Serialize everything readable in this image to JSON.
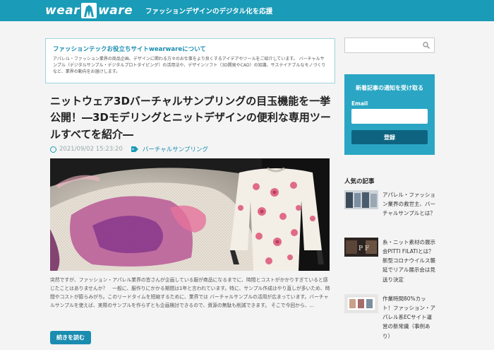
{
  "header": {
    "logo_text_left": "wear",
    "logo_text_right": "ware",
    "tagline": "ファッションデザインのデジタル化を応援"
  },
  "about": {
    "title": "ファッションテックお役立ちサイトwearwareについて",
    "text": "アパレル・ファッション業界の商品企画、デザインに関わる方々のお仕事をより良くするアイデアやツールをご紹介しています。 バーチャルサンプル（デジタルサンプル・デジタルプロトタイピング）の活用法や、デザインソフト（3D開発やCAD）の知識、サステイナブルなモノづくりなど、業界の動向をお届けします。"
  },
  "post": {
    "title": "ニットウェア3Dバーチャルサンプリングの目玉機能を一挙公開！―3Dモデリングとニットデザインの便利な専用ツールすべてを紹介―",
    "date": "2021/09/02 15:23:20",
    "category": "バーチャルサンプリング",
    "excerpt": "突然ですが、ファッション・アパレル業界の皆さんが企画している服が商品になるまでに、時間とコストがかかりすぎていると感じたことはありませんか？　一般に、服作りにかかる期間は1年と言われています。特に、サンプル作成はやり直しが多いため、時間やコストが膨らみがち。このリードタイムを短縮するために、業界では バーチャルサンプルの活用が広まっています。バーチャルサンプルを使えば、実際のサンプルを作らずとも企画検討できるので、資源の無駄も削減できます。 そこで今回から、...",
    "readmore": "続きを読む"
  },
  "sidebar": {
    "search_placeholder": "",
    "newsletter": {
      "title": "新着記事の通知を受け取る",
      "email_label": "Email",
      "email_value": "",
      "submit": "登録"
    },
    "popular_heading": "人気の記事",
    "popular": [
      {
        "title": "アパレル・ファッション業界の救世主、バーチャルサンプルとは？"
      },
      {
        "title": "糸・ニット素材の展示会PITTI FILATIとは？　新型コロナウイルス襲延でリアル展示会は見送り決定"
      },
      {
        "title": "作業時間80%カット！ファッション・アパレル系ECサイト運営の新常識（事例あり）"
      }
    ],
    "thumb2_label": "P F"
  },
  "colors": {
    "brand": "#1a9bb7",
    "accent_dark": "#0e6480",
    "newsletter_bg": "#2aa6c4"
  },
  "icons": {
    "search": "search-icon",
    "date": "clock-icon",
    "category": "tag-icon"
  }
}
